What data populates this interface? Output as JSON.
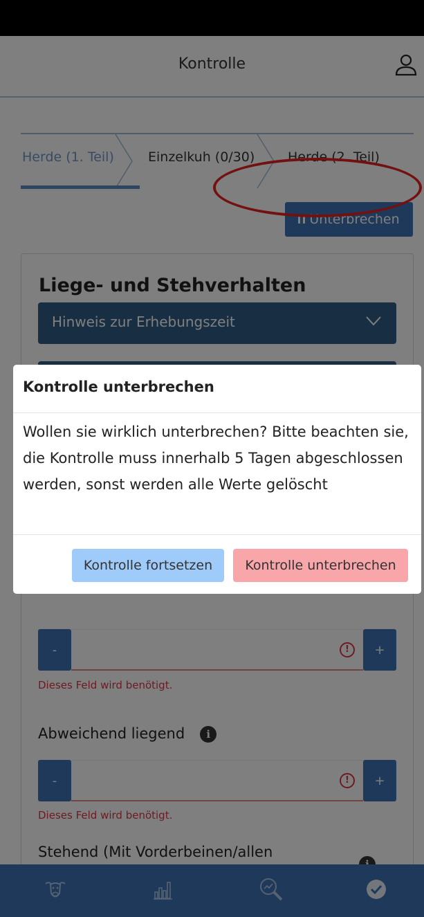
{
  "header": {
    "title": "Kontrolle",
    "user_icon": "user-icon"
  },
  "steps": [
    {
      "label": "Herde (1. Teil)",
      "active": true
    },
    {
      "label": "Einzelkuh (0/30)",
      "active": false
    },
    {
      "label": "Herde (2. Teil)",
      "active": false
    }
  ],
  "pause_button": {
    "label": "Unterbrechen",
    "icon": "pause-icon"
  },
  "card": {
    "title": "Liege- und Stehverhalten",
    "accordion": {
      "label": "Hinweis zur Erhebungszeit",
      "icon": "chevron-down-icon"
    },
    "stepper_minus": "-",
    "stepper_plus": "+",
    "fields": [
      {
        "label": "",
        "error": "Dieses Feld wird benötigt."
      },
      {
        "label": "Abweichend liegend",
        "error": "Dieses Feld wird benötigt."
      },
      {
        "label": "Stehend (Mit Vorderbeinen/allen Beinen)",
        "error": ""
      }
    ],
    "alert_symbol": "!",
    "info_symbol": "i"
  },
  "bottom_nav": {
    "items": [
      {
        "icon": "cow-icon"
      },
      {
        "icon": "bar-chart-icon"
      },
      {
        "icon": "search-chart-icon"
      },
      {
        "icon": "check-circle-icon",
        "active": true
      }
    ]
  },
  "modal": {
    "title": "Kontrolle unterbrechen",
    "body": "Wollen sie wirklich unterbrechen? Bitte beachten sie, die Kontrolle muss innerhalb 5 Tagen abgeschlossen werden, sonst werden alle Werte gelöscht",
    "continue_label": "Kontrolle fortsetzen",
    "interrupt_label": "Kontrolle unterbrechen"
  },
  "colors": {
    "primary": "#3d73b4",
    "accordion": "#2f5d87",
    "continue_button": "#9fcbfa",
    "interrupt_button": "#f9a6aa",
    "error": "#dc3545",
    "annotation_circle": "#e5221e"
  }
}
